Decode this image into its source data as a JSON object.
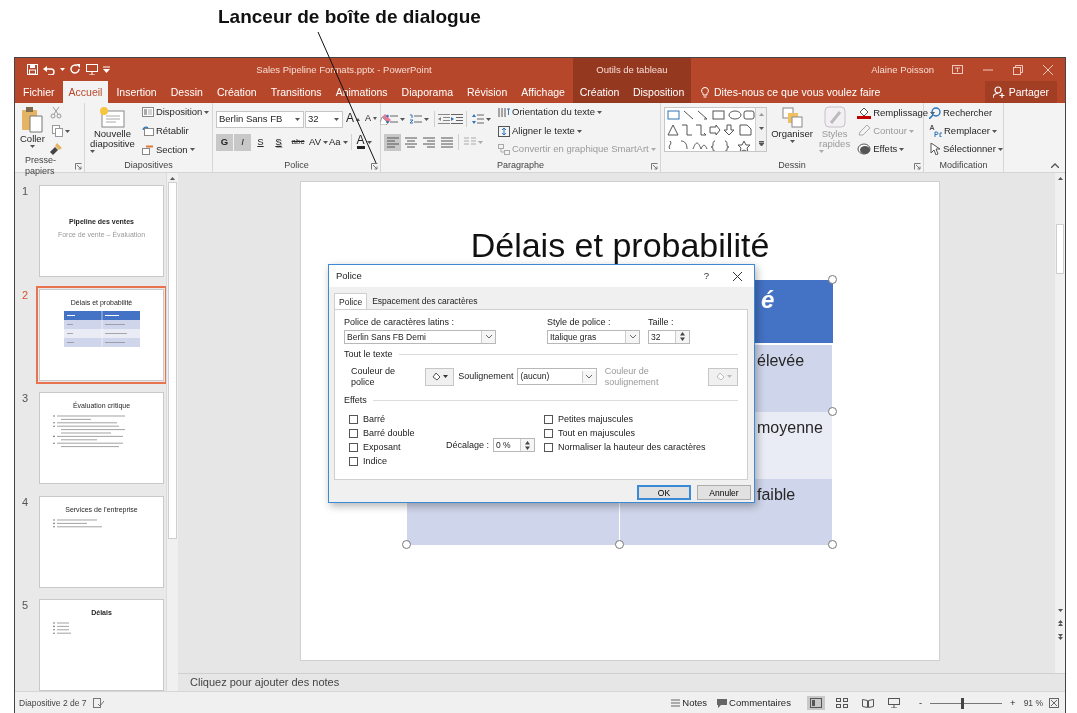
{
  "caption": "Lanceur de boîte de dialogue",
  "window": {
    "title": "Sales Pipeline Formats.pptx - PowerPoint",
    "context_header": "Outils de tableau",
    "user": "Alaine Poisson"
  },
  "tabs": [
    {
      "label": "Fichier",
      "selected": false,
      "contextual": false
    },
    {
      "label": "Accueil",
      "selected": true,
      "contextual": false
    },
    {
      "label": "Insertion",
      "selected": false,
      "contextual": false
    },
    {
      "label": "Dessin",
      "selected": false,
      "contextual": false
    },
    {
      "label": "Création",
      "selected": false,
      "contextual": false
    },
    {
      "label": "Transitions",
      "selected": false,
      "contextual": false
    },
    {
      "label": "Animations",
      "selected": false,
      "contextual": false
    },
    {
      "label": "Diaporama",
      "selected": false,
      "contextual": false
    },
    {
      "label": "Révision",
      "selected": false,
      "contextual": false
    },
    {
      "label": "Affichage",
      "selected": false,
      "contextual": false
    },
    {
      "label": "Création",
      "selected": false,
      "contextual": true
    },
    {
      "label": "Disposition",
      "selected": false,
      "contextual": true
    }
  ],
  "tell_me": "Dites-nous ce que vous voulez faire",
  "share": "Partager",
  "ribbon": {
    "groups": [
      {
        "kind": "clipboard",
        "label": "Presse-papiers",
        "launcher": true,
        "paste": "Coller"
      },
      {
        "kind": "slides",
        "label": "Diapositives",
        "launcher": false,
        "new_slide": "Nouvelle diapositive",
        "commands": [
          {
            "label": "Disposition",
            "dropdown": true,
            "disabled": false
          },
          {
            "label": "Rétablir",
            "dropdown": false,
            "disabled": false
          },
          {
            "label": "Section",
            "dropdown": true,
            "disabled": false
          }
        ]
      },
      {
        "kind": "font",
        "label": "Police",
        "launcher": true,
        "font_name": "Berlin Sans FB",
        "font_size": "32",
        "grow": "A",
        "shrink": "A",
        "color_button": "A",
        "styles": [
          {
            "kind": "bold",
            "label": "G",
            "selected": true
          },
          {
            "kind": "italic",
            "label": "I",
            "selected": true
          },
          {
            "kind": "underline",
            "label": "S",
            "selected": false
          },
          {
            "kind": "shadow",
            "label": "S",
            "selected": false
          },
          {
            "kind": "strike",
            "label": "abc",
            "selected": false
          },
          {
            "kind": "spacing",
            "label": "AV",
            "selected": false
          },
          {
            "kind": "case",
            "label": "Aa",
            "selected": false
          }
        ]
      },
      {
        "kind": "paragraph",
        "label": "Paragraphe",
        "launcher": true,
        "alignments": [
          {
            "kind": "left",
            "selected": true
          },
          {
            "kind": "center",
            "selected": false
          },
          {
            "kind": "right",
            "selected": false
          },
          {
            "kind": "justify",
            "selected": false
          }
        ],
        "commands": [
          {
            "label": "Orientation du texte",
            "dropdown": true,
            "disabled": false
          },
          {
            "label": "Aligner le texte",
            "dropdown": true,
            "disabled": false
          },
          {
            "label": "Convertir en graphique SmartArt",
            "dropdown": true,
            "disabled": true
          }
        ]
      },
      {
        "kind": "drawing",
        "label": "Dessin",
        "launcher": true,
        "arrange": "Organiser",
        "quick_styles": "Styles rapides",
        "quick_styles_disabled": true,
        "commands": [
          {
            "label": "Remplissage",
            "dropdown": true,
            "disabled": false
          },
          {
            "label": "Contour",
            "dropdown": true,
            "disabled": true
          },
          {
            "label": "Effets",
            "dropdown": true,
            "disabled": false
          }
        ]
      },
      {
        "kind": "editing",
        "label": "Modification",
        "launcher": false,
        "commands": [
          {
            "label": "Rechercher",
            "dropdown": false,
            "disabled": false
          },
          {
            "label": "Remplacer",
            "dropdown": true,
            "disabled": false
          },
          {
            "label": "Sélectionner",
            "dropdown": true,
            "disabled": false
          }
        ]
      }
    ]
  },
  "thumbnails": [
    {
      "number": "1",
      "selected": false,
      "kind": "title",
      "title": "Pipeline des ventes",
      "subtitle": "Force de vente – Évaluation"
    },
    {
      "number": "2",
      "selected": true,
      "kind": "table",
      "title": "Délais et probabilité"
    },
    {
      "number": "3",
      "selected": false,
      "kind": "long_bullets",
      "title": "Évaluation critique"
    },
    {
      "number": "4",
      "selected": false,
      "kind": "bullets",
      "title": "Services de l'entreprise"
    },
    {
      "number": "5",
      "selected": false,
      "kind": "short_bullets",
      "title": "Délais"
    }
  ],
  "slide": {
    "title": "Délais et probabilité",
    "header_fragment": "é",
    "cell_fragments": [
      "élevée",
      "moyenne",
      "faible"
    ]
  },
  "notes_placeholder": "Cliquez pour ajouter des notes",
  "dialog": {
    "title": "Police",
    "help": "?",
    "tabs": [
      {
        "label": "Police",
        "selected": true
      },
      {
        "label": "Espacement des caractères",
        "selected": false
      }
    ],
    "latin_font": {
      "label": "Police de caractères latins :",
      "value": "Berlin Sans FB Demi"
    },
    "font_style": {
      "label": "Style de police :",
      "value": "Italique gras"
    },
    "size": {
      "label": "Taille :",
      "value": "32"
    },
    "all_text_heading": "Tout le texte",
    "font_color_label": "Couleur de police",
    "underline": {
      "label": "Soulignement",
      "value": "(aucun)"
    },
    "underline_color": {
      "label": "Couleur de soulignement",
      "disabled": true
    },
    "effects_heading": "Effets",
    "effects_left": [
      {
        "label": "Barré",
        "checked": false
      },
      {
        "label": "Barré double",
        "checked": false
      },
      {
        "label": "Exposant",
        "checked": false
      },
      {
        "label": "Indice",
        "checked": false
      }
    ],
    "effects_right": [
      {
        "label": "Petites majuscules",
        "checked": false
      },
      {
        "label": "Tout en majuscules",
        "checked": false
      },
      {
        "label": "Normaliser la hauteur des caractères",
        "checked": false
      }
    ],
    "offset": {
      "label": "Décalage :",
      "value": "0 %"
    },
    "buttons": [
      {
        "label": "OK",
        "default": true
      },
      {
        "label": "Annuler",
        "default": false
      }
    ]
  },
  "status_bar": {
    "slide_info": "Diapositive 2 de 7",
    "notes": "Notes",
    "comments": "Commentaires",
    "views": [
      {
        "kind": "normal",
        "selected": true
      },
      {
        "kind": "sorter",
        "selected": false
      },
      {
        "kind": "reading",
        "selected": false
      },
      {
        "kind": "slideshow",
        "selected": false
      }
    ],
    "zoom_out": "-",
    "zoom_in": "+",
    "zoom": {
      "level": 0.45
    },
    "zoom_percent": "91 %"
  }
}
